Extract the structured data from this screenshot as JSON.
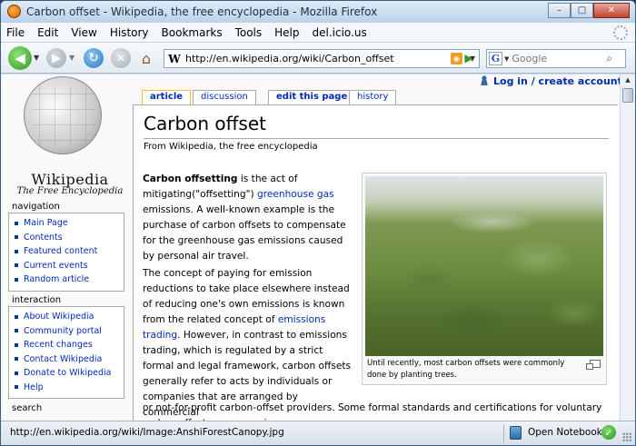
{
  "window": {
    "title": "Carbon offset - Wikipedia, the free encyclopedia - Mozilla Firefox",
    "minimize_glyph": "–",
    "maximize_glyph": "□",
    "close_glyph": "✕"
  },
  "menubar": {
    "items": [
      "File",
      "Edit",
      "View",
      "History",
      "Bookmarks",
      "Tools",
      "Help",
      "del.icio.us"
    ]
  },
  "navbar": {
    "url_favicon_letter": "W",
    "url": "http://en.wikipedia.org/wiki/Carbon_offset",
    "search_engine_letter": "G",
    "search_placeholder": "Google"
  },
  "icons": {
    "back": "arrow-left-icon",
    "forward": "arrow-right-icon",
    "reload": "reload-icon",
    "stop": "stop-icon",
    "home": "home-icon",
    "rss": "rss-feed-icon",
    "go": "go-arrow-icon",
    "search": "magnifier-icon",
    "user": "user-icon",
    "notebook": "notebook-icon",
    "check": "check-icon"
  },
  "sidebar": {
    "logo_word": "Wikipedia",
    "logo_tagline": "The Free Encyclopedia",
    "navigation": {
      "heading": "navigation",
      "items": [
        "Main Page",
        "Contents",
        "Featured content",
        "Current events",
        "Random article"
      ]
    },
    "interaction": {
      "heading": "interaction",
      "items": [
        "About Wikipedia",
        "Community portal",
        "Recent changes",
        "Contact Wikipedia",
        "Donate to Wikipedia",
        "Help"
      ]
    },
    "search": {
      "heading": "search"
    }
  },
  "page_tabs": {
    "article": "article",
    "discussion": "discussion",
    "edit": "edit this page",
    "history": "history"
  },
  "personal": {
    "login": "Log in / create account"
  },
  "article": {
    "title": "Carbon offset",
    "subtitle": "From Wikipedia, the free encyclopedia",
    "p1_bold": "Carbon offsetting",
    "p1_a": " is the act of mitigating(\"offsetting\") ",
    "p1_link": "greenhouse gas",
    "p1_b": " emissions. A well-known example is the purchase of carbon offsets to compensate for the greenhouse gas emissions caused by personal air travel.",
    "p2_a": "The concept of paying for emission reductions to take place elsewhere instead of reducing one's own emissions is known from the related concept of ",
    "p2_link": "emissions trading",
    "p2_b": ". However, in contrast to emissions trading, which is regulated by a strict formal and legal framework, carbon offsets generally refer to acts by individuals or companies that are arranged by commercial",
    "p3": "or not-for-profit carbon-offset providers. Some formal standards and certifications for voluntary carbon offsets are emerging.",
    "image_caption": "Until recently, most carbon offsets were commonly done by planting trees."
  },
  "statusbar": {
    "text": "http://en.wikipedia.org/wiki/Image:AnshiForestCanopy.jpg",
    "notebook_label": "Open Notebook"
  }
}
